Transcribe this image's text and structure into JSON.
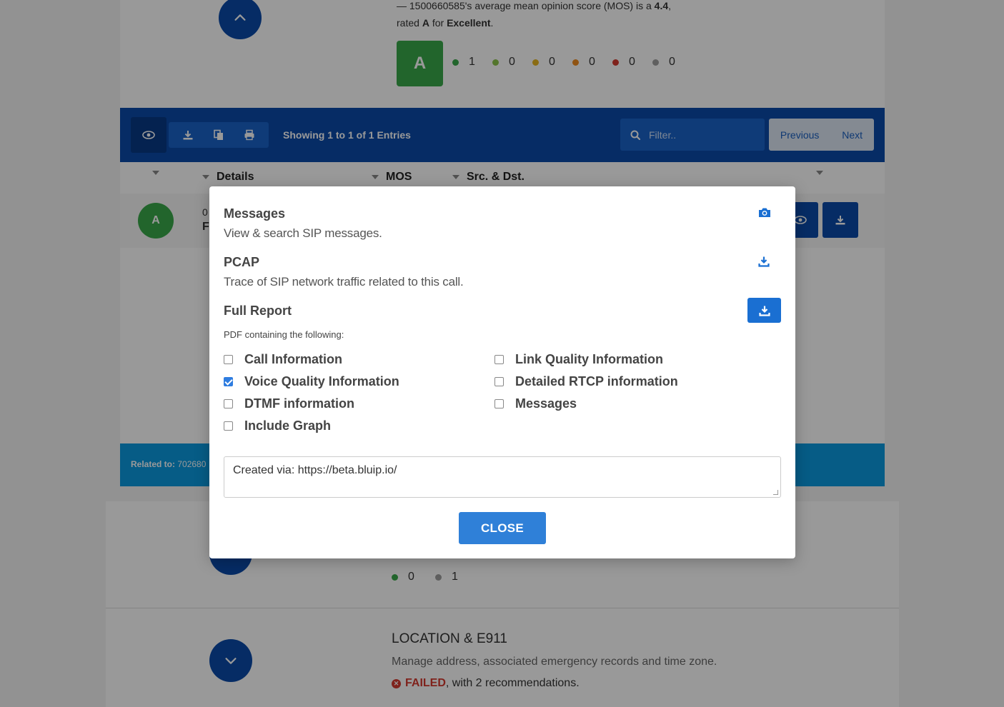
{
  "background": {
    "mos_summary": {
      "line1_prefix": "— 1500660585's average mean opinion score (MOS) is a ",
      "mos_value": "4.4",
      "line1_suffix": ",",
      "line2_prefix": "rated ",
      "grade": "A",
      "line2_mid": " for ",
      "grade_label": "Excellent",
      "line2_suffix": "."
    },
    "grade_box": "A",
    "grade_counts": [
      {
        "color": "#3aa84a",
        "value": "1"
      },
      {
        "color": "#8bc34a",
        "value": "0"
      },
      {
        "color": "#e6b422",
        "value": "0"
      },
      {
        "color": "#ef8a1e",
        "value": "0"
      },
      {
        "color": "#d43a2f",
        "value": "0"
      },
      {
        "color": "#9e9e9e",
        "value": "0"
      }
    ],
    "toolbar": {
      "showing_text": "Showing 1 to 1 of 1 Entries",
      "filter_placeholder": "Filter..",
      "previous_label": "Previous",
      "next_label": "Next"
    },
    "table_headers": [
      "Details",
      "MOS",
      "Src. & Dst."
    ],
    "row": {
      "avatar": "A",
      "detail_line1": "0",
      "detail_line2": "F"
    },
    "related_label": "Related to:",
    "related_value": "702680",
    "endpoint_counts": [
      {
        "color": "#3aa84a",
        "value": "0"
      },
      {
        "color": "#9e9e9e",
        "value": "1"
      }
    ],
    "location": {
      "title": "LOCATION & E911",
      "description": "Manage address, associated emergency records and time zone.",
      "status_failed": "FAILED",
      "status_rest": ", with 2 recommendations."
    }
  },
  "modal": {
    "messages": {
      "title": "Messages",
      "description": "View & search SIP messages.",
      "icon": "camera-icon"
    },
    "pcap": {
      "title": "PCAP",
      "description": "Trace of SIP network traffic related to this call.",
      "icon": "download-icon"
    },
    "full_report": {
      "title": "Full Report",
      "description": "PDF containing the following:",
      "icon": "download-icon"
    },
    "options": [
      {
        "label": "Call Information",
        "checked": false
      },
      {
        "label": "Voice Quality Information",
        "checked": true
      },
      {
        "label": "DTMF information",
        "checked": false
      },
      {
        "label": "Include Graph",
        "checked": false
      },
      {
        "label": "Link Quality Information",
        "checked": false
      },
      {
        "label": "Detailed RTCP information",
        "checked": false
      },
      {
        "label": "Messages",
        "checked": false
      }
    ],
    "notes_value": "Created via: https://beta.bluip.io/",
    "close_label": "CLOSE"
  },
  "colors": {
    "primary_dark": "#0a4aa8",
    "primary": "#2f80d8",
    "success": "#3aa84a",
    "danger": "#d43a2f",
    "related_bar": "#0a99e0"
  }
}
